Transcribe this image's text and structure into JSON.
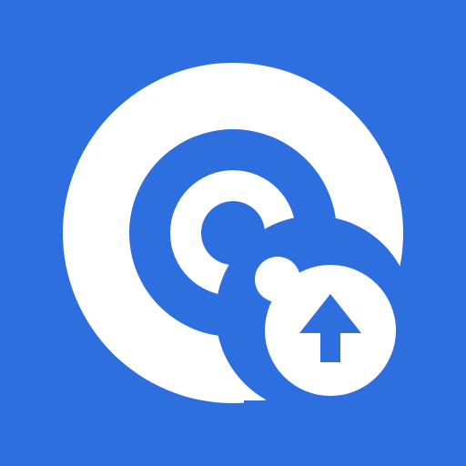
{
  "icon": {
    "name": "radar-upload-icon",
    "colors": {
      "background": "#2E6FE0",
      "foreground": "#FFFFFF"
    },
    "badge_icon": "arrow-up-icon"
  }
}
